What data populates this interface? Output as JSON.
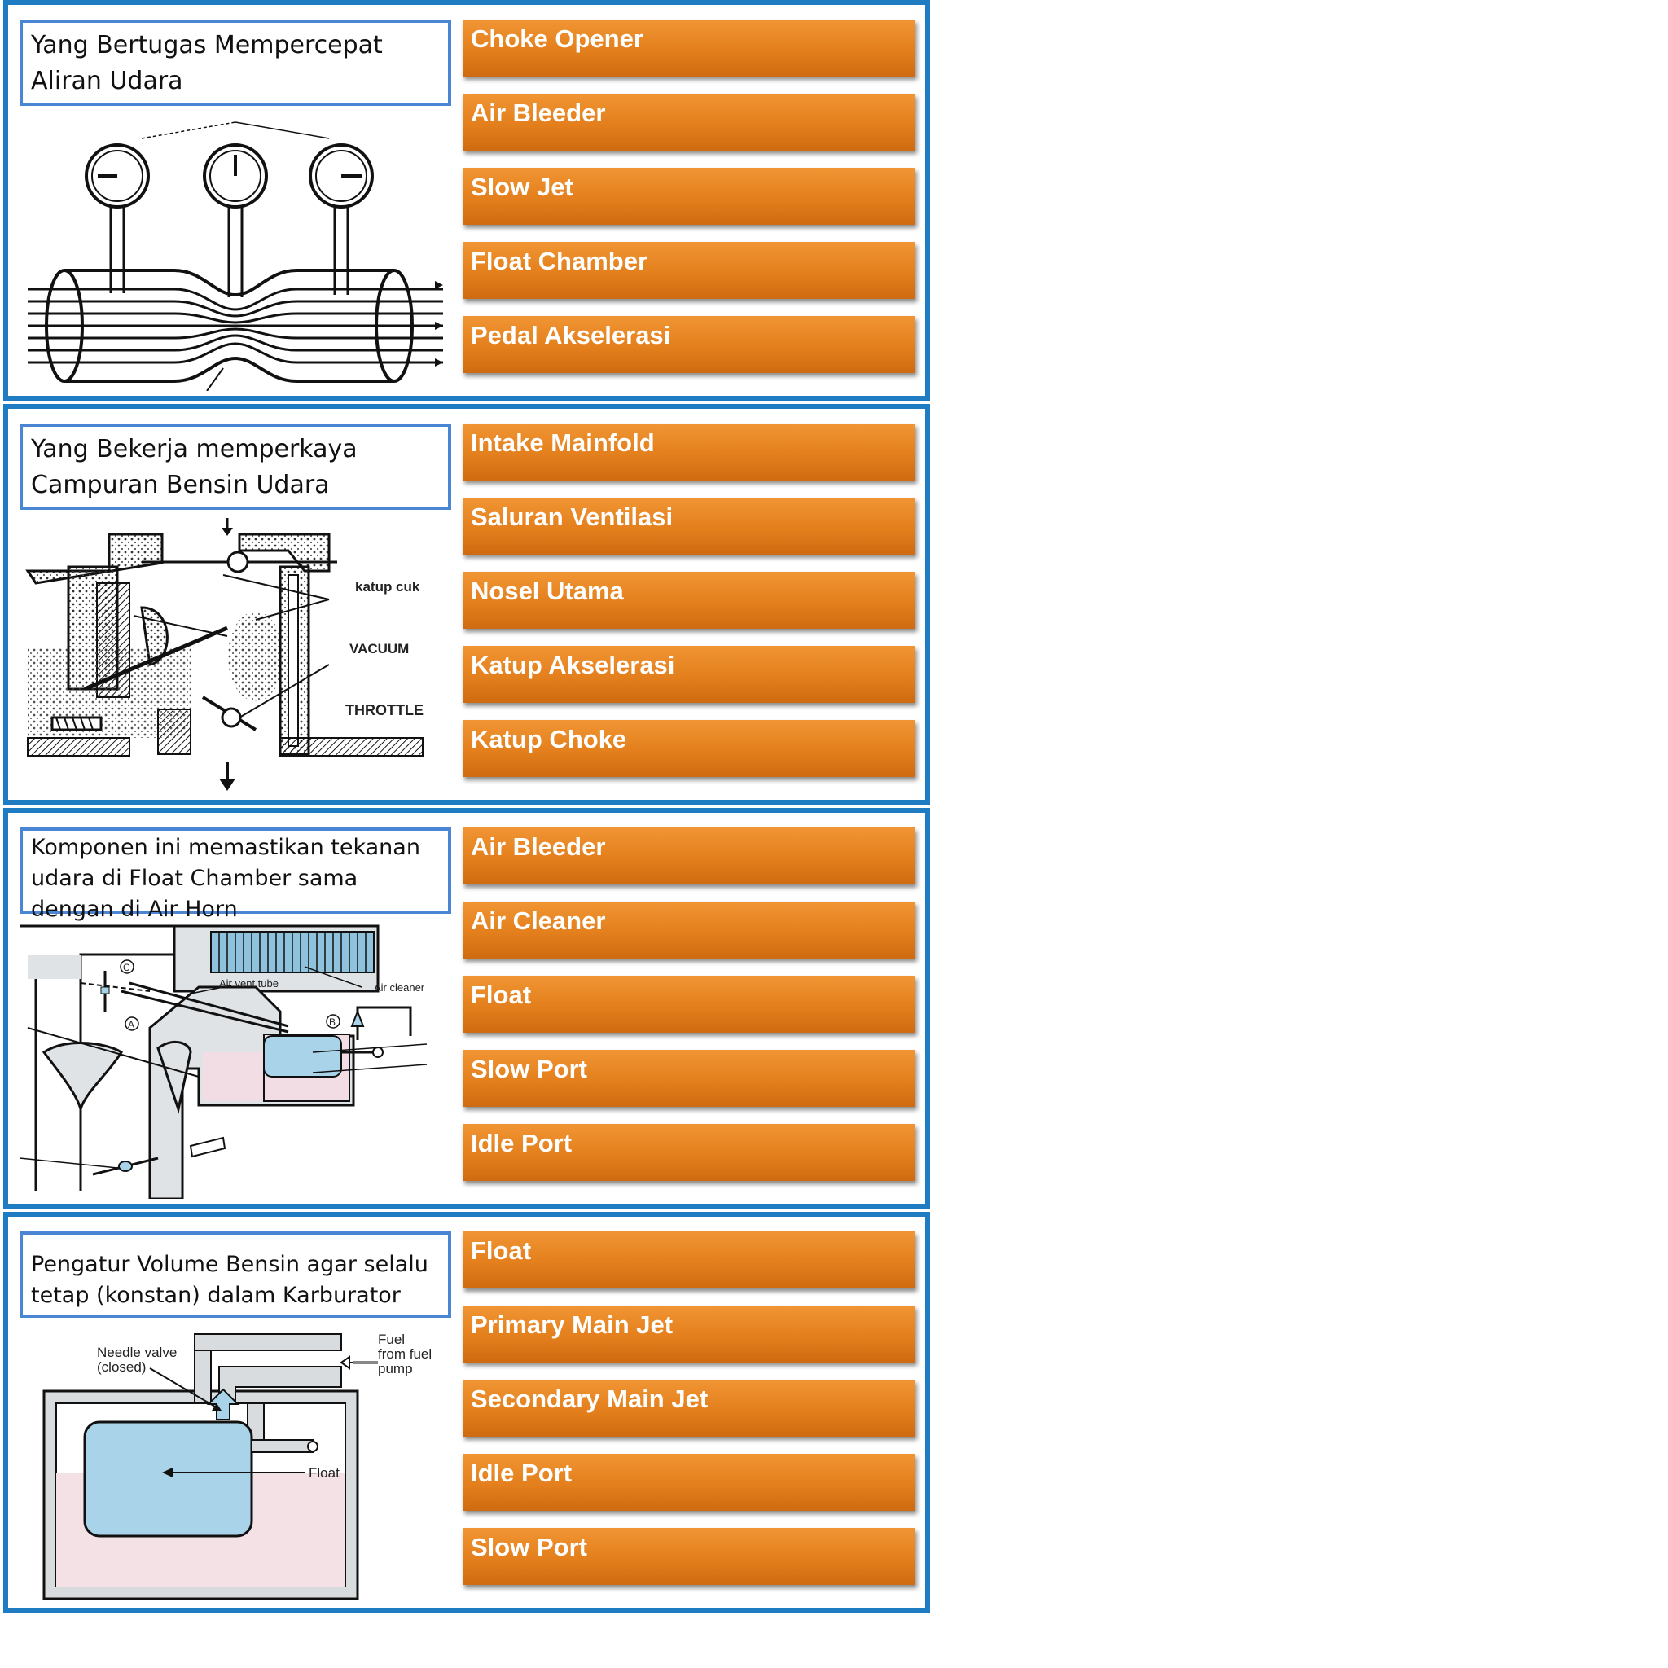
{
  "colors": {
    "panel_border": "#1f7bc2",
    "question_border": "#4a86d4",
    "option_fill": "#e8821f",
    "option_text": "#ffffff"
  },
  "panels": [
    {
      "question": "Yang Bertugas Mempercepat Aliran Udara",
      "options": [
        "Choke Opener",
        "Air Bleeder",
        "Slow Jet",
        "Float Chamber",
        "Pedal Akselerasi"
      ]
    },
    {
      "question": "Yang Bekerja memperkaya Campuran Bensin Udara",
      "diagram_labels": [
        "katup cuk",
        "VACUUM",
        "THROTTLE"
      ],
      "options": [
        "Intake Mainfold",
        "Saluran Ventilasi",
        "Nosel Utama",
        "Katup Akselerasi",
        "Katup Choke"
      ]
    },
    {
      "question": "Komponen ini memastikan tekanan udara di Float Chamber sama dengan di Air Horn",
      "diagram_labels": [
        "Air vent tube",
        "Air cleaner",
        "C",
        "A",
        "B"
      ],
      "options": [
        "Air Bleeder",
        "Air Cleaner",
        "Float",
        "Slow Port",
        "Idle Port"
      ]
    },
    {
      "question": "Pengatur Volume Bensin agar selalu tetap (konstan) dalam Karburator",
      "diagram_labels": [
        "Needle valve",
        "(closed)",
        "Fuel",
        "from fuel",
        "pump",
        "Float"
      ],
      "options": [
        "Float",
        "Primary Main Jet",
        "Secondary Main Jet",
        "Idle Port",
        "Slow Port"
      ]
    }
  ]
}
